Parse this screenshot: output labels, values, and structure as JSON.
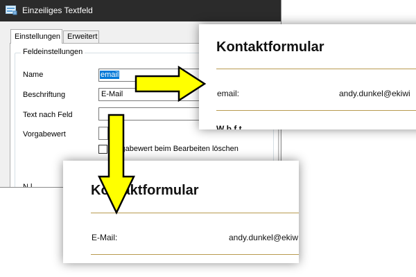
{
  "dialog": {
    "title": "Einzeiliges Textfeld",
    "tabs": [
      "Einstellungen",
      "Erweitert"
    ],
    "group_title": "Feldeinstellungen",
    "fields": [
      {
        "label": "Name",
        "value": "email"
      },
      {
        "label": "Beschriftung",
        "value": "E-Mail"
      },
      {
        "label": "Text nach Feld",
        "value": ""
      },
      {
        "label": "Vorgabewert",
        "value": ""
      }
    ],
    "checkbox_label": "Vorgabewert beim Bearbeiten löschen",
    "partial_label": "N    l"
  },
  "preview_top": {
    "heading": "Kontaktformular",
    "label": "email:",
    "value": "andy.dunkel@ekiwi",
    "cut_text": "W  b    f    t"
  },
  "preview_bottom": {
    "heading": "Kontaktformular",
    "label": "E-Mail:",
    "value": "andy.dunkel@ekiw"
  },
  "colors": {
    "arrow_fill": "#ffff00",
    "arrow_stroke": "#000000",
    "rule": "#b89a4e",
    "selection": "#0078d7"
  }
}
